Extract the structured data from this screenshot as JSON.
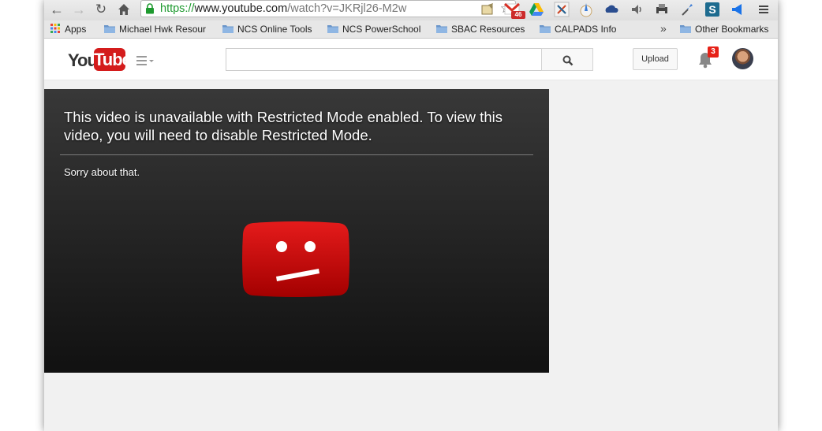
{
  "browser": {
    "url": {
      "scheme": "https://",
      "host": "www.youtube.com",
      "path": "/watch?v=JKRjl26-M2w"
    },
    "gmail_unread": "46",
    "bookmarks": [
      {
        "label": "Apps",
        "type": "apps"
      },
      {
        "label": "Michael Hwk Resour",
        "type": "folder"
      },
      {
        "label": "NCS Online Tools",
        "type": "folder"
      },
      {
        "label": "NCS PowerSchool",
        "type": "folder"
      },
      {
        "label": "SBAC Resources",
        "type": "folder"
      },
      {
        "label": "CALPADS Info",
        "type": "folder"
      }
    ],
    "overflow": "»",
    "other_bookmarks": "Other Bookmarks"
  },
  "youtube": {
    "logo_you": "You",
    "logo_tube": "Tube",
    "search_placeholder": "",
    "upload_label": "Upload",
    "notification_count": "3"
  },
  "player": {
    "error_title": "This video is unavailable with Restricted Mode enabled. To view this video, you will need to disable Restricted Mode.",
    "error_sub": "Sorry about that."
  },
  "colors": {
    "accent_red": "#d41c1c",
    "player_bg": "#1c1c1c",
    "page_bg": "#f1f1f1"
  }
}
